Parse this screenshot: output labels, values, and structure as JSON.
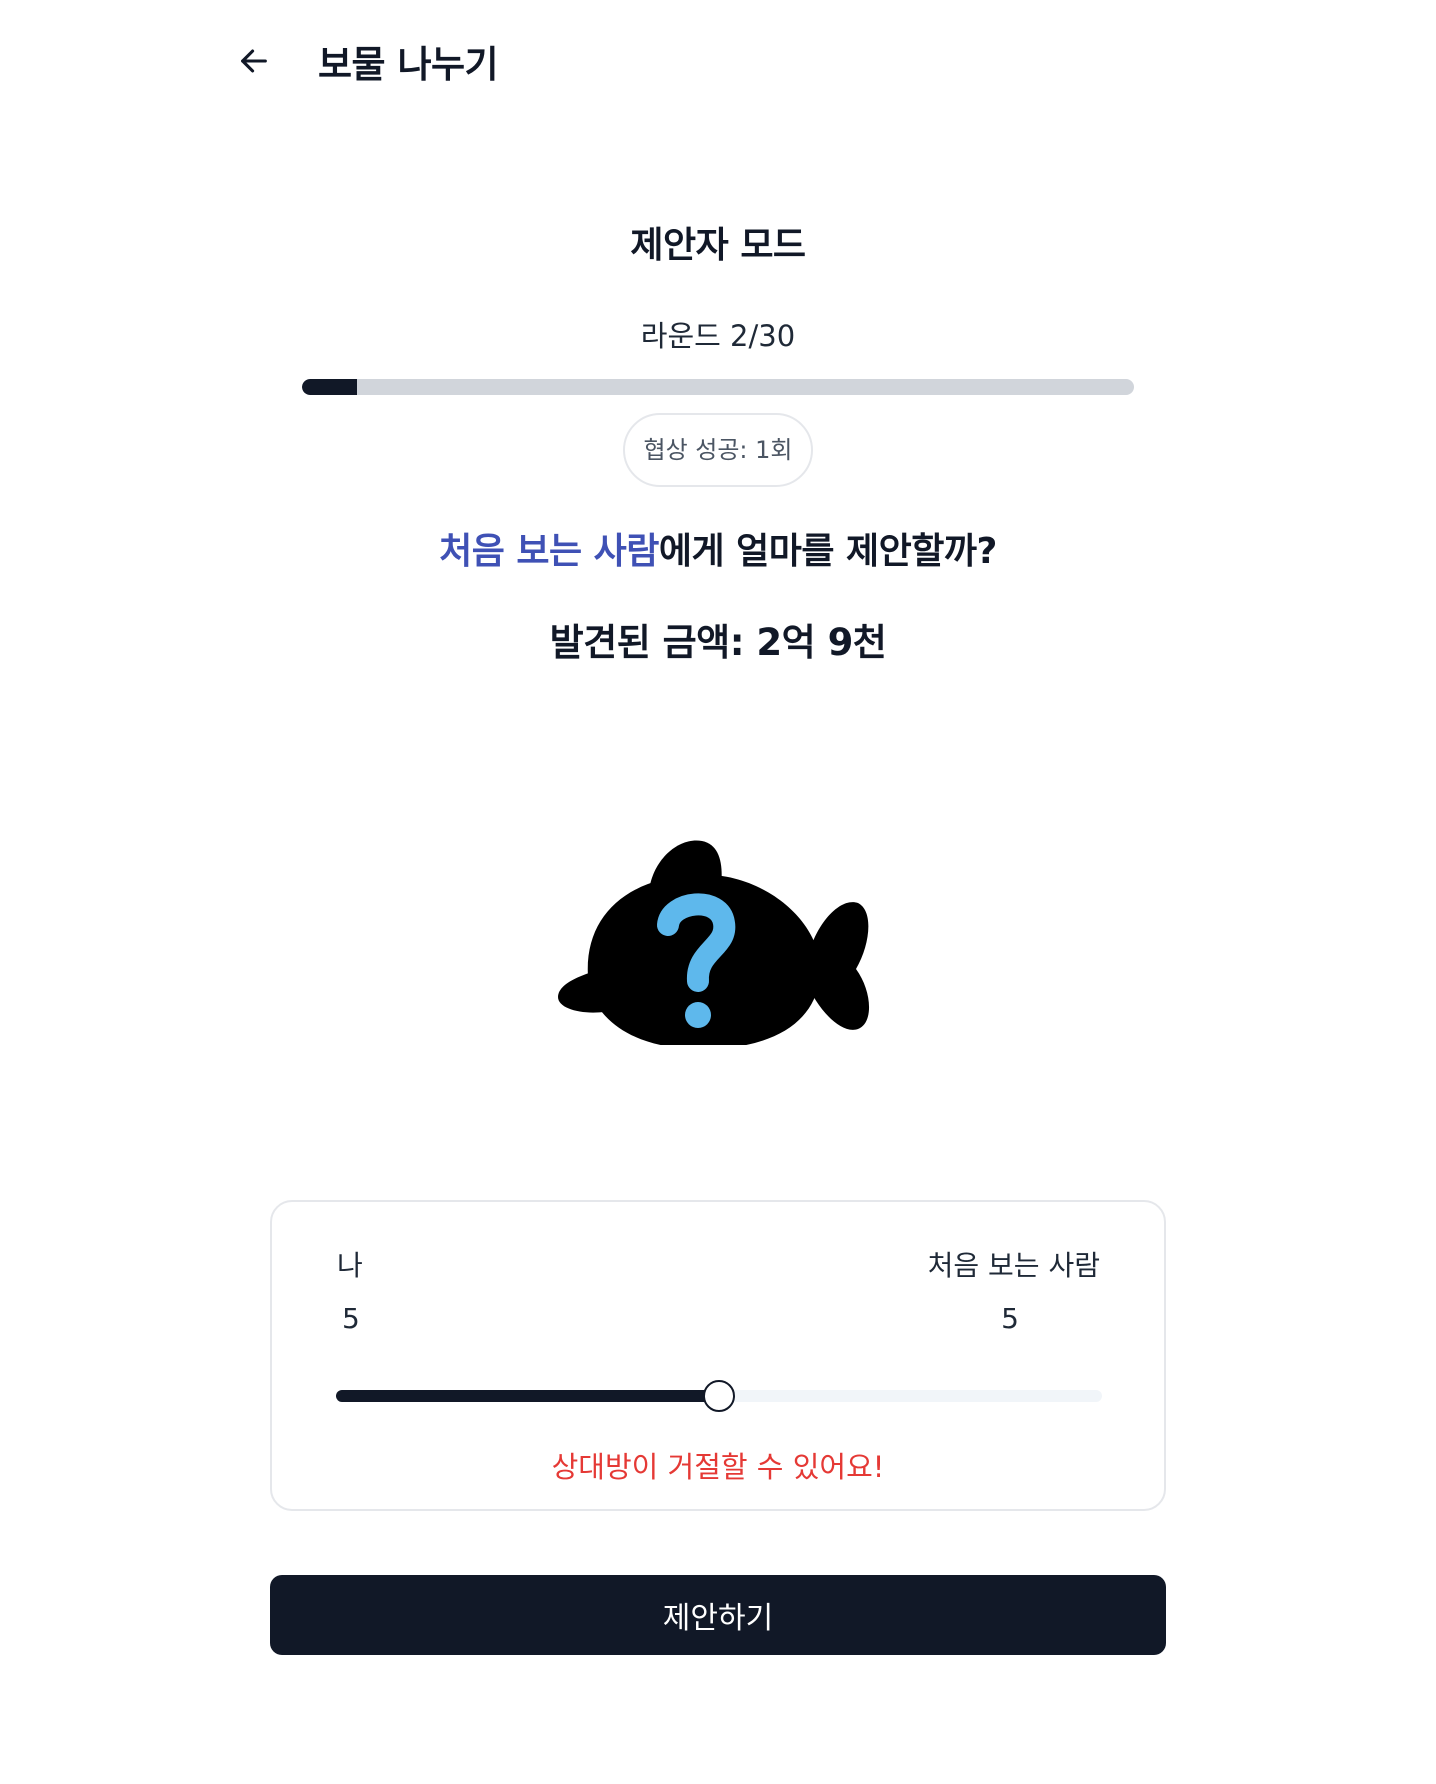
{
  "header": {
    "title": "보물 나누기",
    "back_icon": "arrow-left-icon"
  },
  "mode_title": "제안자 모드",
  "round": {
    "text": "라운드 2/30",
    "current": 2,
    "total": 30
  },
  "success_badge": "협상 성공: 1회",
  "question": {
    "partner": "처음 보는 사람",
    "rest": "에게 얼마를 제안할까?"
  },
  "found_amount": "발견된 금액: 2억 9천",
  "illustration": "mystery-fish-icon",
  "split": {
    "me_label": "나",
    "me_value": "5",
    "partner_label": "처음 보는 사람",
    "partner_value": "5",
    "slider_fraction": 0.5
  },
  "warning": "상대방이 거절할 수 있어요!",
  "submit_label": "제안하기",
  "colors": {
    "primary": "#111827",
    "accent": "#3f51b5",
    "warning": "#e53935",
    "question_mark": "#5eb8ec"
  }
}
